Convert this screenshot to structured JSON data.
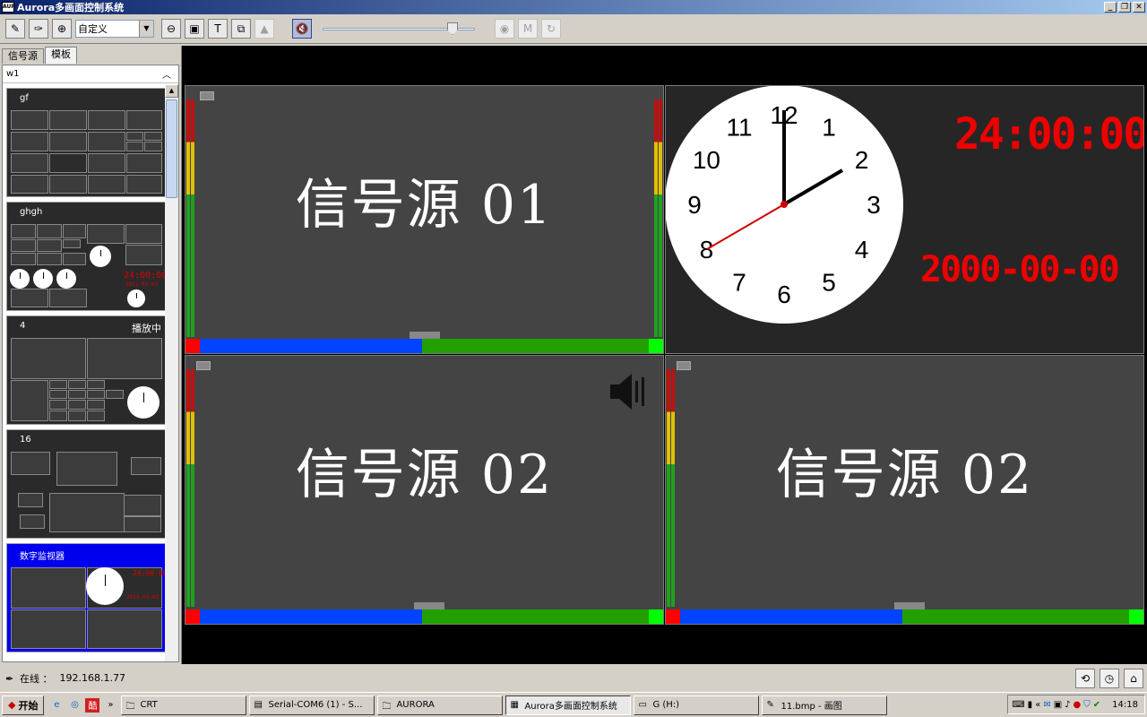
{
  "window": {
    "title": "Aurora多画面控制系统",
    "icon_text": "AUR"
  },
  "toolbar": {
    "zoom_value": "自定义",
    "volume_level": 0.88
  },
  "left_panel": {
    "tabs": [
      "信号源",
      "模板"
    ],
    "group_name": "w1",
    "templates": [
      {
        "name": "gf",
        "badge": ""
      },
      {
        "name": "ghgh",
        "badge": "",
        "time": "24:00:00",
        "date": "2021-03-02"
      },
      {
        "name": "4",
        "badge": "播放中"
      },
      {
        "name": "16",
        "badge": ""
      },
      {
        "name": "数字监视器",
        "badge": "",
        "time": "24:00:00",
        "date": "2023-03-02"
      }
    ]
  },
  "main": {
    "cells": [
      {
        "label": "信号源 01"
      },
      {
        "label": "信号源 02"
      },
      {
        "label": "信号源 02"
      }
    ],
    "clock": {
      "numbers": [
        "12",
        "1",
        "2",
        "3",
        "4",
        "5",
        "6",
        "7",
        "8",
        "9",
        "10",
        "11"
      ],
      "time": "24:00:00",
      "date": "2000-00-00"
    }
  },
  "status": {
    "online_label": "在线 ：",
    "ip": "192.168.1.77"
  },
  "taskbar": {
    "start": "开始",
    "tasks": [
      "CRT",
      "Serial-COM6 (1) - S...",
      "AURORA",
      "Aurora多画面控制系统",
      "G (H:)",
      "11.bmp - 画图"
    ],
    "clock": "14:18"
  }
}
